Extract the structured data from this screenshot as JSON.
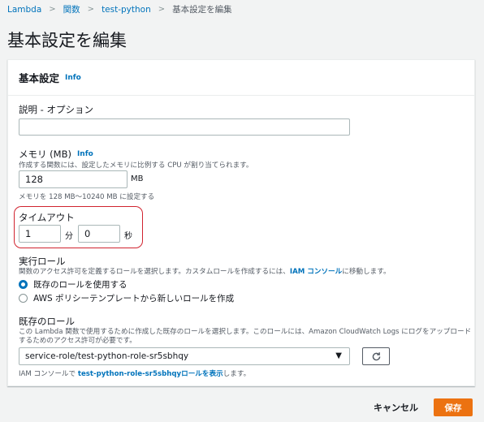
{
  "breadcrumb": {
    "items": [
      "Lambda",
      "関数",
      "test-python"
    ],
    "current": "基本設定を編集"
  },
  "page_title": "基本設定を編集",
  "panel": {
    "title": "基本設定",
    "info": "Info"
  },
  "description": {
    "label": "説明 - オプション",
    "value": ""
  },
  "memory": {
    "label": "メモリ (MB)",
    "info": "Info",
    "desc": "作成する関数には、設定したメモリに比例する CPU が割り当てられます。",
    "value": "128",
    "unit": "MB",
    "hint": "メモリを 128 MB～10240 MB に設定する"
  },
  "timeout": {
    "label": "タイムアウト",
    "minutes": "1",
    "minutes_unit": "分",
    "seconds": "0",
    "seconds_unit": "秒",
    "highlight_color": "#d1232f"
  },
  "execution_role": {
    "label": "実行ロール",
    "desc_prefix": "関数のアクセス許可を定義するロールを選択します。カスタムロールを作成するには、",
    "desc_link": "IAM コンソール",
    "desc_suffix": "に移動します。",
    "options": [
      {
        "label": "既存のロールを使用する",
        "checked": true
      },
      {
        "label": "AWS ポリシーテンプレートから新しいロールを作成",
        "checked": false
      }
    ]
  },
  "existing_role": {
    "label": "既存のロール",
    "desc_line1": "この Lambda 関数で使用するために作成した既存のロールを選択します。このロールには、Amazon CloudWatch Logs にログをアップロード",
    "desc_line2": "するためのアクセス許可が必要です。",
    "selected": "service-role/test-python-role-sr5sbhqy",
    "footer_prefix": "IAM コンソールで ",
    "footer_link": "test-python-role-sr5sbhqyロールを表示",
    "footer_suffix": "します。"
  },
  "actions": {
    "cancel": "キャンセル",
    "save": "保存"
  },
  "colors": {
    "link": "#0073bb",
    "primary_button": "#ec7211",
    "highlight": "#d1232f"
  }
}
